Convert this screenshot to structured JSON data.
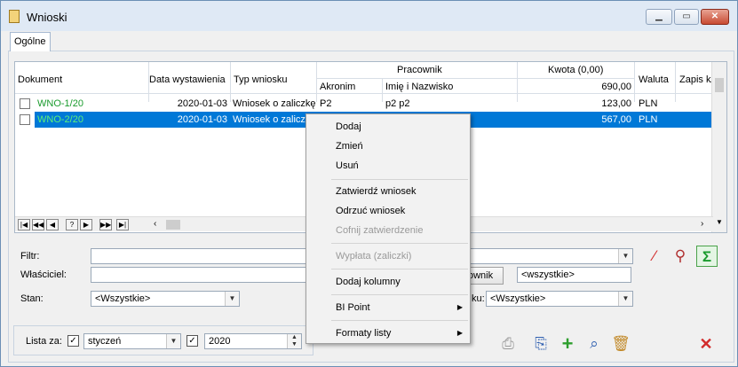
{
  "window": {
    "title": "Wnioski",
    "min": "▁",
    "max": "▭",
    "close": "✕"
  },
  "tabs": [
    {
      "label": "Ogólne"
    }
  ],
  "grid": {
    "headers": {
      "dokument": "Dokument",
      "data": "Data wystawienia",
      "typ": "Typ wniosku",
      "pracownik": "Pracownik",
      "akronim": "Akronim",
      "imie": "Imię i Nazwisko",
      "kwota": "Kwota (0,00)",
      "kwota_total": "690,00",
      "waluta": "Waluta",
      "zapis": "Zapis k/"
    },
    "rows": [
      {
        "dokument": "WNO-1/20",
        "data": "2020-01-03",
        "typ": "Wniosek o zaliczkę",
        "akronim": "P2",
        "imie": "p2 p2",
        "kwota": "123,00",
        "waluta": "PLN"
      },
      {
        "dokument": "WNO-2/20",
        "data": "2020-01-03",
        "typ": "Wniosek o zaliczkę",
        "akronim": "",
        "imie": "",
        "kwota": "567,00",
        "waluta": "PLN"
      }
    ],
    "nav": [
      "|◀",
      "◀◀",
      "◀",
      "?",
      "▶",
      "▶▶",
      "▶|"
    ]
  },
  "filters": {
    "filtr_label": "Filtr:",
    "wlasciciel_label": "Właściciel:",
    "stan_label": "Stan:",
    "stan_value": "<Wszystkie>",
    "pracownik_button": "ownik",
    "pracownik_value": "<wszystkie>",
    "typ_label": "ku:",
    "typ_value": "<Wszystkie>"
  },
  "lista": {
    "label": "Lista za:",
    "month": "styczeń",
    "year": "2020"
  },
  "context_menu": {
    "items": [
      {
        "label": "Dodaj",
        "disabled": false
      },
      {
        "label": "Zmień",
        "disabled": false
      },
      {
        "label": "Usuń",
        "disabled": false
      },
      {
        "label": "Zatwierdź wniosek",
        "disabled": false
      },
      {
        "label": "Odrzuć wniosek",
        "disabled": false
      },
      {
        "label": "Cofnij zatwierdzenie",
        "disabled": true
      },
      {
        "label": "Wypłata (zaliczki)",
        "disabled": true
      },
      {
        "label": "Dodaj kolumny",
        "disabled": false
      },
      {
        "label": "BI Point",
        "disabled": false,
        "submenu": true
      },
      {
        "label": "Formaty listy",
        "disabled": false,
        "submenu": true
      }
    ]
  },
  "colors": {
    "selection": "#0078d7",
    "doc_link": "#1a9b2d",
    "add_icon": "#2e9e2e",
    "close_icon": "#d22b2b"
  }
}
